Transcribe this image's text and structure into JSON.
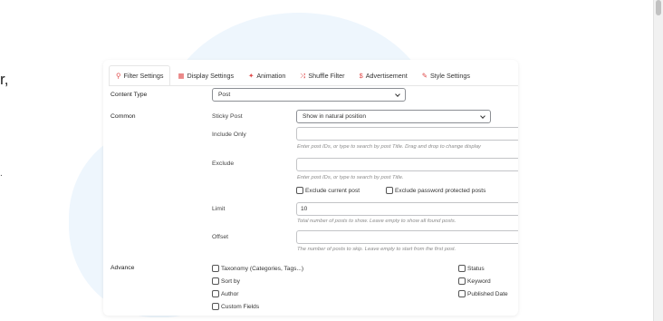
{
  "background": {
    "edge_text": "r,",
    "edge_dot": "."
  },
  "tabs": [
    {
      "label": "Filter Settings",
      "icon": "search-icon",
      "glyph": "⚲",
      "active": true
    },
    {
      "label": "Display Settings",
      "icon": "grid-icon",
      "glyph": "▦",
      "active": false
    },
    {
      "label": "Animation",
      "icon": "sparkle-icon",
      "glyph": "✦",
      "active": false
    },
    {
      "label": "Shuffle Filter",
      "icon": "shuffle-icon",
      "glyph": "⤨",
      "active": false
    },
    {
      "label": "Advertisement",
      "icon": "dollar-icon",
      "glyph": "$",
      "active": false
    },
    {
      "label": "Style Settings",
      "icon": "brush-icon",
      "glyph": "✎",
      "active": false
    }
  ],
  "content_type": {
    "label": "Content Type",
    "value": "Post"
  },
  "common": {
    "label": "Common",
    "sticky_post": {
      "label": "Sticky Post",
      "value": "Show in natural position"
    },
    "include_only": {
      "label": "Include Only",
      "value": "",
      "help": "Enter post IDs, or type to search by post Title. Drag and drop to change display"
    },
    "exclude": {
      "label": "Exclude",
      "value": "",
      "help": "Enter post IDs, or type to search by post Title.",
      "exclude_current": "Exclude current post",
      "exclude_protected": "Exclude password protected posts"
    },
    "limit": {
      "label": "Limit",
      "value": "10",
      "help": "Total number of posts to show. Leave empty to show all found posts."
    },
    "offset": {
      "label": "Offset",
      "value": "",
      "help": "The number of posts to skip. Leave empty to start from the first post."
    }
  },
  "advance": {
    "label": "Advance",
    "left_options": [
      "Taxonomy (Categories, Tags...)",
      "Sort by",
      "Author",
      "Custom Fields"
    ],
    "right_options": [
      "Status",
      "Keyword",
      "Published Date"
    ]
  },
  "colors": {
    "accent": "#e04b4b",
    "blob": "#eef6fd"
  }
}
